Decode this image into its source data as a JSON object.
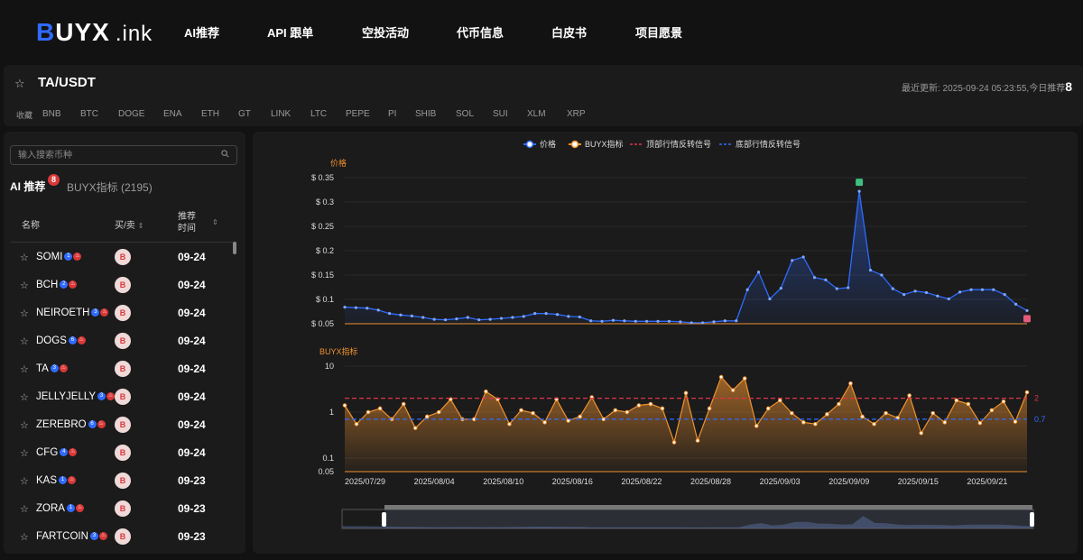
{
  "nav": {
    "logo_b": "B",
    "logo_rest": "UYX",
    "logo_ink": ".ink",
    "items": [
      "AI推荐",
      "API 跟单",
      "空投活动",
      "代币信息",
      "白皮书",
      "项目愿景"
    ]
  },
  "ticker": {
    "pair": "TA/USDT",
    "update_text": "最近更新: 2025-09-24 05:23:55,今日推荐",
    "today_count": "8",
    "fav_label": "收藏",
    "coins": [
      "BNB",
      "BTC",
      "DOGE",
      "ENA",
      "ETH",
      "GT",
      "LINK",
      "LTC",
      "PEPE",
      "PI",
      "SHIB",
      "SOL",
      "SUI",
      "XLM",
      "XRP"
    ]
  },
  "left": {
    "search_placeholder": "输入搜索币种",
    "tab_ai": "AI 推荐",
    "tab_ai_badge": "8",
    "tab_buyx": "BUYX指标 (2195)",
    "col_name": "名称",
    "col_action": "买/卖",
    "col_time": "推荐时间",
    "rows": [
      {
        "symbol": "SOMI",
        "n": "1",
        "action": "B",
        "date": "09-24"
      },
      {
        "symbol": "BCH",
        "n": "2",
        "action": "B",
        "date": "09-24"
      },
      {
        "symbol": "NEIROETH",
        "n": "3",
        "action": "B",
        "date": "09-24"
      },
      {
        "symbol": "DOGS",
        "n": "6",
        "action": "B",
        "date": "09-24"
      },
      {
        "symbol": "TA",
        "n": "3",
        "action": "B",
        "date": "09-24"
      },
      {
        "symbol": "JELLYJELLY",
        "n": "3",
        "action": "B",
        "date": "09-24"
      },
      {
        "symbol": "ZEREBRO",
        "n": "6",
        "action": "B",
        "date": "09-24"
      },
      {
        "symbol": "CFG",
        "n": "4",
        "action": "B",
        "date": "09-24"
      },
      {
        "symbol": "KAS",
        "n": "1",
        "action": "B",
        "date": "09-23"
      },
      {
        "symbol": "ZORA",
        "n": "1",
        "action": "B",
        "date": "09-23"
      },
      {
        "symbol": "FARTCOIN",
        "n": "3",
        "action": "B",
        "date": "09-23"
      }
    ]
  },
  "chart_data": {
    "type": "line",
    "legend": [
      "价格",
      "BUYX指标",
      "顶部行情反转信号",
      "底部行情反转信号"
    ],
    "colors": {
      "price": "#2f6bff",
      "buyx": "#f0922f",
      "top": "#e0344a",
      "bottom": "#2f6bff"
    },
    "price_label": "价格",
    "price_ticks": [
      "$ 0.35",
      "$ 0.3",
      "$ 0.25",
      "$ 0.2",
      "$ 0.15",
      "$ 0.1",
      "$ 0.05"
    ],
    "price_ylim": [
      0.05,
      0.35
    ],
    "buyx_label": "BUYX指标",
    "buyx_ticks": [
      "10",
      "1",
      "0.1",
      "0.05"
    ],
    "buyx_scale": "log",
    "top_line_value": 2,
    "top_line_label": "2",
    "bottom_line_value": 0.7,
    "bottom_line_label": "0.7",
    "x_ticks": [
      "2025/07/29",
      "2025/08/04",
      "2025/08/10",
      "2025/08/16",
      "2025/08/22",
      "2025/08/28",
      "2025/09/03",
      "2025/09/09",
      "2025/09/15",
      "2025/09/21"
    ],
    "price_values": [
      0.084,
      0.083,
      0.082,
      0.078,
      0.071,
      0.068,
      0.066,
      0.063,
      0.059,
      0.058,
      0.06,
      0.063,
      0.058,
      0.059,
      0.061,
      0.063,
      0.065,
      0.071,
      0.071,
      0.069,
      0.065,
      0.064,
      0.056,
      0.055,
      0.057,
      0.056,
      0.055,
      0.055,
      0.055,
      0.055,
      0.054,
      0.052,
      0.052,
      0.054,
      0.056,
      0.056,
      0.12,
      0.156,
      0.101,
      0.123,
      0.18,
      0.187,
      0.145,
      0.14,
      0.122,
      0.124,
      0.322,
      0.16,
      0.15,
      0.122,
      0.11,
      0.117,
      0.114,
      0.107,
      0.101,
      0.115,
      0.12,
      0.12,
      0.12,
      0.11,
      0.09,
      0.077
    ],
    "buyx_values": [
      1.4,
      0.55,
      1.0,
      1.2,
      0.7,
      1.5,
      0.45,
      0.8,
      1.0,
      1.9,
      0.7,
      0.7,
      2.8,
      1.9,
      0.55,
      1.1,
      0.95,
      0.6,
      1.9,
      0.65,
      0.8,
      2.1,
      0.7,
      1.1,
      1.0,
      1.4,
      1.5,
      1.2,
      0.22,
      2.6,
      0.24,
      1.2,
      5.8,
      3.0,
      5.4,
      0.5,
      1.2,
      1.8,
      0.95,
      0.6,
      0.55,
      0.9,
      1.5,
      4.2,
      0.8,
      0.55,
      0.95,
      0.75,
      2.3,
      0.35,
      0.95,
      0.6,
      1.8,
      1.5,
      0.58,
      1.1,
      1.7,
      0.62,
      2.7
    ]
  }
}
